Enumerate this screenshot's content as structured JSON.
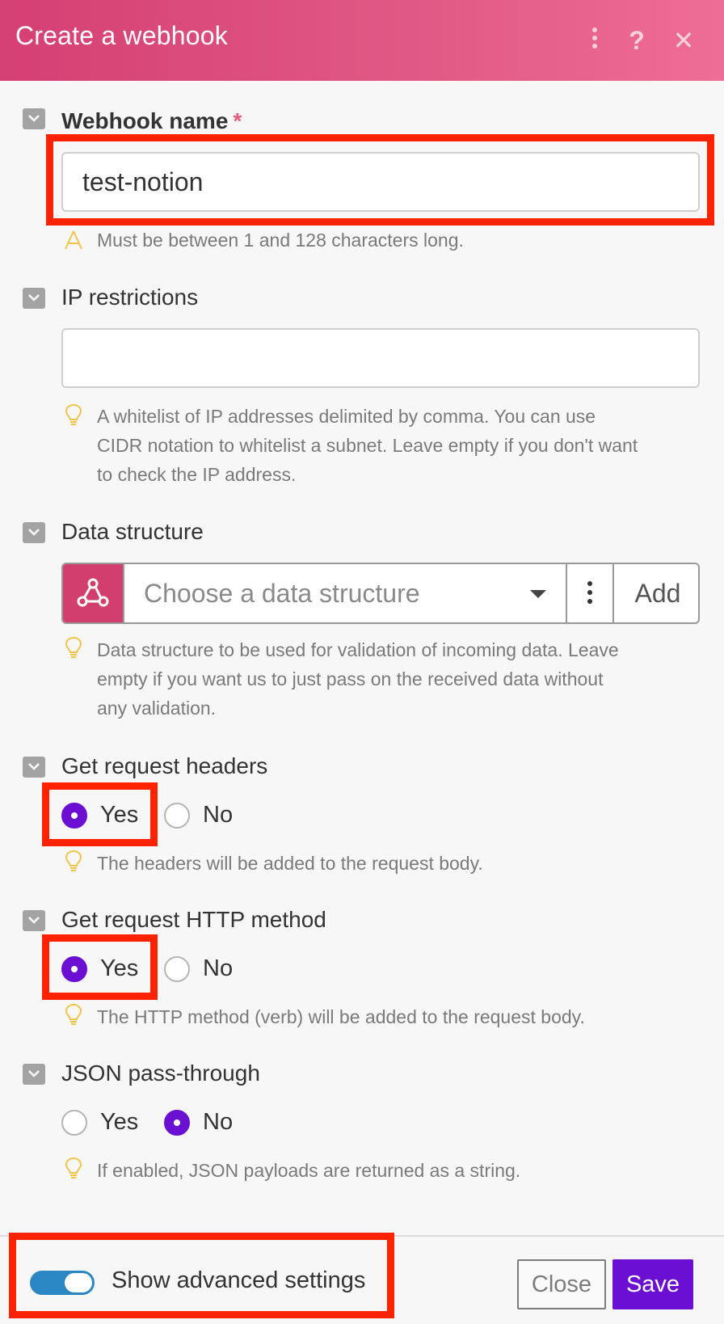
{
  "header": {
    "title": "Create a webhook",
    "help_glyph": "?",
    "close_glyph": "✕",
    "background_colors": [
      "#d53f73",
      "#ee6d96"
    ]
  },
  "fields": {
    "webhook_name": {
      "label": "Webhook name",
      "required_mark": "*",
      "value": "test-notion",
      "hint": "Must be between 1 and 128 characters long."
    },
    "ip_restrictions": {
      "label": "IP restrictions",
      "value": "",
      "hint_lines": [
        "A whitelist of IP addresses delimited by comma. You can use",
        "CIDR notation to whitelist a subnet. Leave empty if you don't want",
        "to check the IP address."
      ]
    },
    "data_structure": {
      "label": "Data structure",
      "placeholder": "Choose a data structure",
      "add_label": "Add",
      "hint_lines": [
        "Data structure to be used for validation of incoming data. Leave",
        "empty if you want us to just pass on the received data without",
        "any validation."
      ]
    },
    "get_request_headers": {
      "label": "Get request headers",
      "options": [
        "Yes",
        "No"
      ],
      "selected": "Yes",
      "hint": "The headers will be added to the request body."
    },
    "get_request_http_method": {
      "label": "Get request HTTP method",
      "options": [
        "Yes",
        "No"
      ],
      "selected": "Yes",
      "hint": "The HTTP method (verb) will be added to the request body."
    },
    "json_pass_through": {
      "label": "JSON pass-through",
      "options": [
        "Yes",
        "No"
      ],
      "selected": "No",
      "hint": "If enabled, JSON payloads are returned as a string."
    }
  },
  "footer": {
    "advanced_toggle_label": "Show advanced settings",
    "advanced_toggle_on": true,
    "close_label": "Close",
    "save_label": "Save"
  },
  "colors": {
    "accent_purple": "#6b0fd3",
    "toggle_blue": "#2b86c4",
    "highlight_red": "#ff2200",
    "hint_icon_yellow": "#f3c44a"
  },
  "icons": [
    "kebab-menu-icon",
    "help-icon",
    "close-icon",
    "collapse-chevron-icon",
    "warning-icon",
    "lightbulb-icon",
    "webhook-icon",
    "dropdown-caret-icon"
  ]
}
